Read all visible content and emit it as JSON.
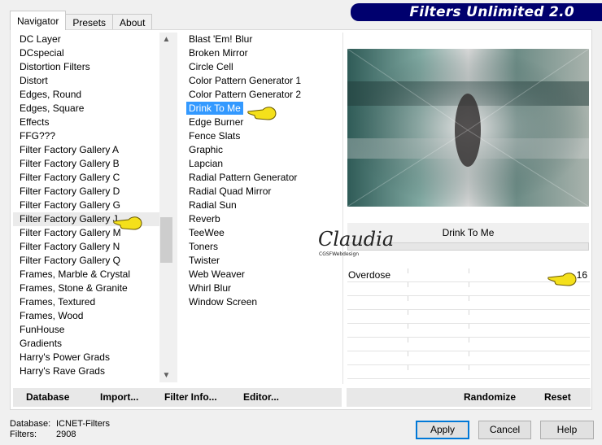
{
  "app_title": "Filters Unlimited 2.0",
  "tabs": [
    "Navigator",
    "Presets",
    "About"
  ],
  "categories": [
    "DC Layer",
    "DCspecial",
    "Distortion Filters",
    "Distort",
    "Edges, Round",
    "Edges, Square",
    "Effects",
    "FFG???",
    "Filter Factory Gallery A",
    "Filter Factory Gallery B",
    "Filter Factory Gallery C",
    "Filter Factory Gallery D",
    "Filter Factory Gallery G",
    "Filter Factory Gallery J",
    "Filter Factory Gallery M",
    "Filter Factory Gallery N",
    "Filter Factory Gallery Q",
    "Frames, Marble & Crystal",
    "Frames, Stone & Granite",
    "Frames, Textured",
    "Frames, Wood",
    "FunHouse",
    "Gradients",
    "Harry's Power Grads",
    "Harry's Rave Grads"
  ],
  "selected_category": "Filter Factory Gallery J",
  "filters": [
    "Blast 'Em! Blur",
    "Broken Mirror",
    "Circle Cell",
    "Color Pattern Generator 1",
    "Color Pattern Generator 2",
    "Drink To Me",
    "Edge Burner",
    "Fence Slats",
    "Graphic",
    "Lapcian",
    "Radial Pattern Generator",
    "Radial Quad Mirror",
    "Radial Sun",
    "Reverb",
    "TeeWee",
    "Toners",
    "Twister",
    "Web Weaver",
    "Whirl Blur",
    "Window Screen"
  ],
  "selected_filter": "Drink To Me",
  "filter_name_display": "Drink To Me",
  "params": [
    {
      "name": "Overdose",
      "value": "16"
    }
  ],
  "watermark": {
    "name": "Claudia",
    "sub": "CGSFWebdesign"
  },
  "bottom_left_buttons": {
    "database": "Database",
    "import": "Import...",
    "filter_info": "Filter Info...",
    "editor": "Editor..."
  },
  "bottom_right_buttons": {
    "randomize": "Randomize",
    "reset": "Reset"
  },
  "status": {
    "database_label": "Database:",
    "database_value": "ICNET-Filters",
    "filters_label": "Filters:",
    "filters_value": "2908"
  },
  "dialog_buttons": {
    "apply": "Apply",
    "cancel": "Cancel",
    "help": "Help"
  },
  "colors": {
    "banner": "#00006e",
    "selection": "#3399ff",
    "hand": "#f4e01b"
  }
}
